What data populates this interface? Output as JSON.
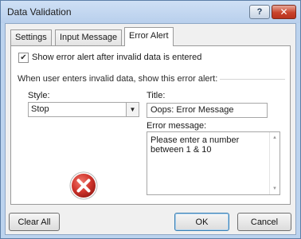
{
  "window": {
    "title": "Data Validation",
    "help_label": "?",
    "close_label": "✕"
  },
  "tabs": [
    {
      "label": "Settings",
      "active": false
    },
    {
      "label": "Input Message",
      "active": false
    },
    {
      "label": "Error Alert",
      "active": true
    }
  ],
  "error_alert": {
    "show_alert_checked": true,
    "show_alert_label": "Show error alert after invalid data is entered",
    "group_label": "When user enters invalid data, show this error alert:",
    "style_label": "Style:",
    "style_value": "Stop",
    "title_label": "Title:",
    "title_value": "Oops: Error Message",
    "message_label": "Error message:",
    "message_value": "Please enter a number between 1 & 10"
  },
  "buttons": {
    "clear_all": "Clear All",
    "ok": "OK",
    "cancel": "Cancel"
  },
  "icons": {
    "checkbox_check": "✔",
    "dropdown_arrow": "▼",
    "scroll_up": "▲",
    "scroll_down": "▼",
    "stop_icon": "stop-error-icon"
  },
  "colors": {
    "titlebar": "#bcd3ee",
    "close_button": "#c9432b",
    "stop_icon_red": "#d0342c"
  }
}
